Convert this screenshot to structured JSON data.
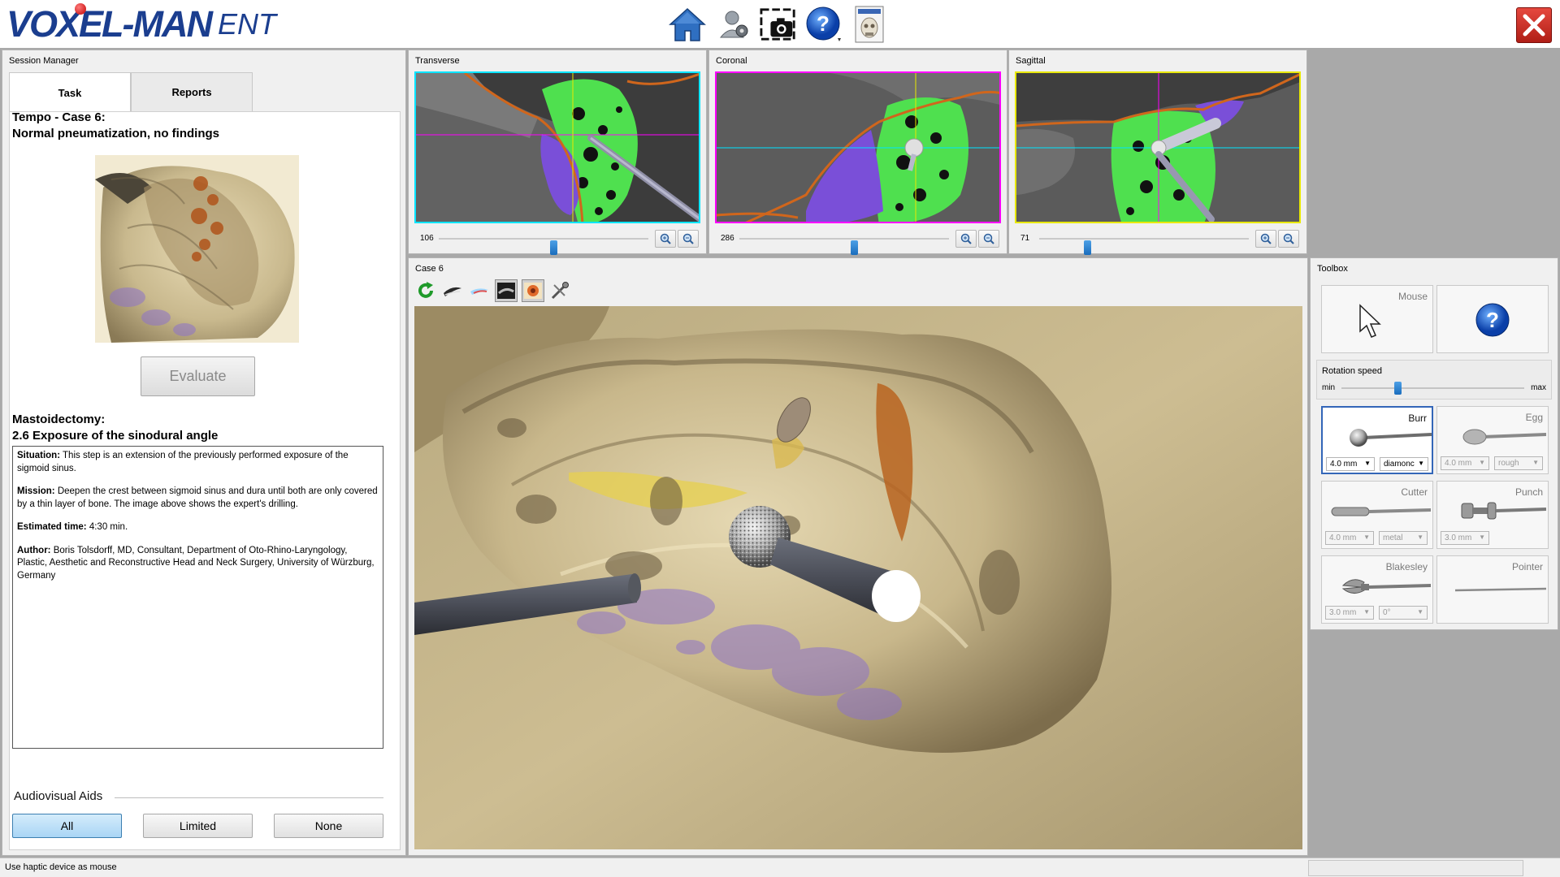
{
  "app": {
    "logo_main": "VOXEL-MAN",
    "logo_sub": "ENT"
  },
  "toolbar": {
    "icons": [
      "home-icon",
      "user-settings-icon",
      "screenshot-camera-icon",
      "help-icon",
      "anatomy-book-icon",
      "close-icon"
    ]
  },
  "session": {
    "title": "Session Manager",
    "tabs": [
      {
        "label": "Task",
        "active": true
      },
      {
        "label": "Reports",
        "active": false
      }
    ],
    "case_title_1": "Tempo - Case 6:",
    "case_title_2": "Normal pneumatization, no findings",
    "evaluate_label": "Evaluate",
    "step_title_1": "Mastoidectomy:",
    "step_title_2": "2.6 Exposure of the sinodural angle",
    "situation_label": "Situation:",
    "situation_text": " This step is an extension of the previously performed exposure of the sigmoid sinus.",
    "mission_label": "Mission:",
    "mission_text": " Deepen the crest between sigmoid sinus and dura until both are only covered by a thin layer of bone. The image above shows the expert's drilling.",
    "time_label": "Estimated time:",
    "time_text": " 4:30 min.",
    "author_label": "Author:",
    "author_text": " Boris Tolsdorff, MD, Consultant, Department of Oto-Rhino-Laryngology, Plastic, Aesthetic and Reconstructive Head and Neck Surgery, University of Würzburg, Germany",
    "av_label": "Audiovisual Aids",
    "av_buttons": [
      {
        "label": "All",
        "active": true
      },
      {
        "label": "Limited",
        "active": false
      },
      {
        "label": "None",
        "active": false
      }
    ]
  },
  "slices": {
    "transverse": {
      "title": "Transverse",
      "value": "106",
      "frame_color": "#00e5ff",
      "position": 0.55
    },
    "coronal": {
      "title": "Coronal",
      "value": "286",
      "frame_color": "#ff00ff",
      "position": 0.55
    },
    "sagittal": {
      "title": "Sagittal",
      "value": "71",
      "frame_color": "#e8e800",
      "position": 0.22
    }
  },
  "main_view": {
    "title": "Case 6",
    "tool_icons": [
      "reset-rotation-icon",
      "drill-path-icon",
      "tool-trace-icon",
      "bone-surface-icon",
      "expert-view-icon",
      "tool-settings-icon"
    ]
  },
  "toolbox": {
    "title": "Toolbox",
    "mouse_label": "Mouse",
    "rotation_label": "Rotation speed",
    "rotation_min": "min",
    "rotation_max": "max",
    "rotation_value": 0.3,
    "tools": {
      "burr": {
        "label": "Burr",
        "size": "4.0 mm",
        "type": "diamonc",
        "selected": true
      },
      "egg": {
        "label": "Egg",
        "size": "4.0 mm",
        "type": "rough"
      },
      "cutter": {
        "label": "Cutter",
        "size": "4.0 mm",
        "type": "metal"
      },
      "punch": {
        "label": "Punch",
        "size": "3.0 mm"
      },
      "blakesley": {
        "label": "Blakesley",
        "size": "3.0 mm",
        "angle": "0°"
      },
      "pointer": {
        "label": "Pointer"
      }
    }
  },
  "status": {
    "text": "Use haptic device as mouse"
  },
  "colors": {
    "brand": "#1b3e8f",
    "accent": "#3366b8",
    "bone": "#cfc09a",
    "air_cells": "#4fe04f",
    "dura": "#7a4fd8"
  }
}
